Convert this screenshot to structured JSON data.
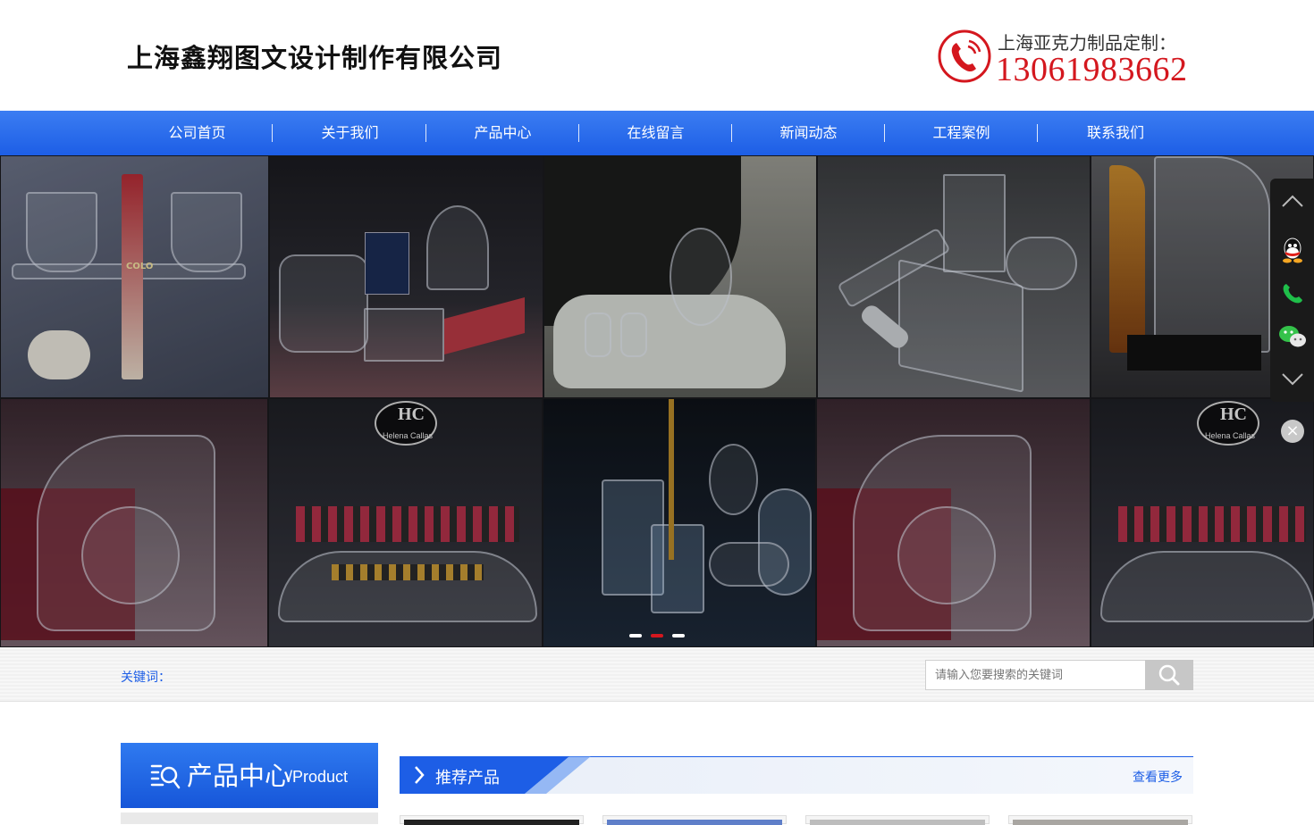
{
  "header": {
    "company_name": "上海鑫翔图文设计制作有限公司",
    "hotline_label": "上海亚克力制品定制：",
    "hotline_number": "13061983662",
    "phone_icon": "phone-icon"
  },
  "nav": {
    "items": [
      "公司首页",
      "关于我们",
      "产品中心",
      "在线留言",
      "新闻动态",
      "工程案例",
      "联系我们"
    ]
  },
  "banner": {
    "slide_count": 3,
    "active_slide": 2,
    "tile_labels": [
      "COLO",
      "HC",
      "Helena Callas",
      "HC",
      "Helena Callas"
    ]
  },
  "side_toolbar": {
    "buttons": [
      "chevron-up-icon",
      "qq-icon",
      "phone-icon",
      "wechat-icon",
      "chevron-down-icon"
    ],
    "close": "×"
  },
  "search": {
    "keywords_label": "关键词：",
    "placeholder": "请输入您要搜索的关键词"
  },
  "product_center": {
    "title": "产品中心",
    "subtitle": "/Product"
  },
  "recommended": {
    "title": "推荐产品",
    "more": "查看更多"
  },
  "colors": {
    "nav_blue": "#1d5ee6",
    "hotline_red": "#d4171e",
    "accent_blue": "#2f7af0"
  }
}
